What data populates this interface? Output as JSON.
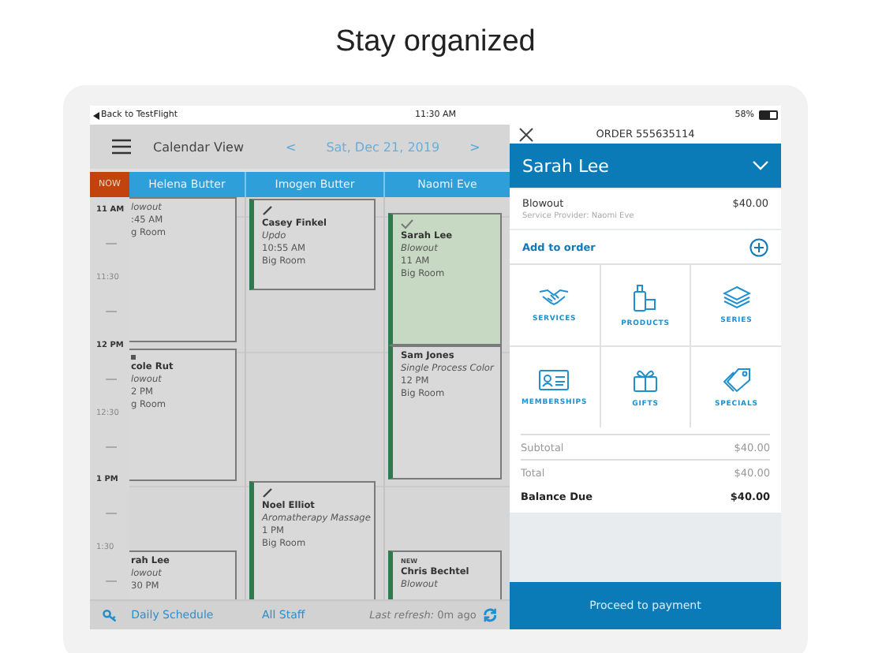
{
  "headline": "Stay organized",
  "status_bar": {
    "back": "Back to TestFlight",
    "time": "11:30 AM",
    "battery": "58%",
    "level": 0.58
  },
  "calendar": {
    "title": "Calendar View",
    "prev": "<",
    "date": "Sat, Dec 21, 2019",
    "next": ">",
    "now": "NOW",
    "staff": [
      "Helena Butter",
      "Imogen Butter",
      "Naomi Eve"
    ],
    "times": [
      "11 AM",
      "11:30",
      "12 PM",
      "12:30",
      "1 PM",
      "1:30"
    ],
    "columns": [
      [
        {
          "kind": "plain",
          "service": "lowout",
          "time": ":45 AM",
          "room": "g Room"
        },
        {
          "kind": "flag",
          "client": "cole Rut",
          "service": "lowout",
          "time": "2 PM",
          "room": "g Room"
        },
        {
          "kind": "plain",
          "client": "rah Lee",
          "service": "lowout",
          "time": "30 PM"
        }
      ],
      [
        {
          "kind": "edit",
          "client": "Casey Finkel",
          "service": "Updo",
          "time": "10:55 AM",
          "room": "Big Room"
        },
        {
          "kind": "edit",
          "client": "Noel Elliot",
          "service": "Aromatherapy Massage",
          "time": "1 PM",
          "room": "Big Room"
        }
      ],
      [
        {
          "kind": "checked",
          "client": "Sarah Lee",
          "service": "Blowout",
          "time": "11 AM",
          "room": "Big Room"
        },
        {
          "kind": "plain",
          "client": "Sam Jones",
          "service": "Single Process Color",
          "time": "12 PM",
          "room": "Big Room"
        },
        {
          "kind": "new",
          "tag": "NEW",
          "client": "Chris Bechtel",
          "service": "Blowout"
        }
      ]
    ],
    "footer": {
      "schedule": "Daily Schedule",
      "staff": "All Staff",
      "refresh": "*Last refresh:* 0m ago"
    }
  },
  "order": {
    "title": "ORDER 555635114",
    "client": "Sarah Lee",
    "items": [
      {
        "name": "Blowout",
        "price": "$40.00",
        "provider": "Service Provider: Naomi Eve"
      }
    ],
    "add_label": "Add to order",
    "tiles": [
      {
        "kind": "services",
        "label": "SERVICES"
      },
      {
        "kind": "products",
        "label": "PRODUCTS"
      },
      {
        "kind": "series",
        "label": "SERIES"
      },
      {
        "kind": "memberships",
        "label": "MEMBERSHIPS"
      },
      {
        "kind": "gifts",
        "label": "GIFTS"
      },
      {
        "kind": "specials",
        "label": "SPECIALS"
      }
    ],
    "totals": [
      {
        "label": "Subtotal",
        "value": "$40.00",
        "bold": false
      },
      {
        "label": "Total",
        "value": "$40.00",
        "bold": false
      },
      {
        "label": "Balance Due",
        "value": "$40.00",
        "bold": true
      }
    ],
    "pay_button": "Proceed to payment"
  }
}
